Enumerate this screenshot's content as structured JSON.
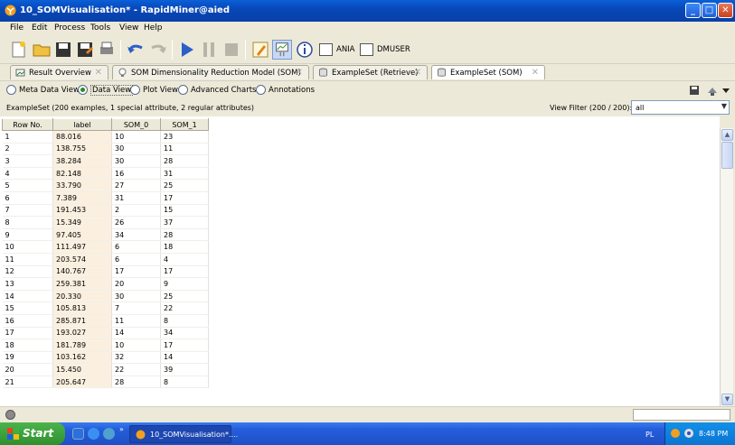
{
  "window": {
    "title": "10_SOMVisualisation* - RapidMiner@aied",
    "min": "_",
    "max": "□",
    "close": "✕"
  },
  "menu": [
    "File",
    "Edit",
    "Process",
    "Tools",
    "View",
    "Help"
  ],
  "toolbar": {
    "check1_label": "ANIA",
    "check2_label": "DMUSER"
  },
  "tabs": [
    {
      "label": "Result Overview",
      "icon": "result-overview-icon"
    },
    {
      "label": "SOM Dimensionality Reduction Model (SOM)",
      "icon": "lightbulb-icon"
    },
    {
      "label": "ExampleSet (Retrieve)",
      "icon": "table-icon"
    },
    {
      "label": "ExampleSet (SOM)",
      "icon": "table-icon"
    }
  ],
  "views": [
    "Meta Data View",
    "Data View",
    "Plot View",
    "Advanced Charts",
    "Annotations"
  ],
  "selected_view": "Data View",
  "info": {
    "summary": "ExampleSet (200 examples, 1 special attribute, 2 regular attributes)",
    "view_filter_label": "View Filter (200 / 200):",
    "filter_value": "all"
  },
  "table": {
    "columns": [
      "Row No.",
      "label",
      "SOM_0",
      "SOM_1"
    ],
    "rows": [
      [
        "1",
        "88.016",
        "10",
        "23"
      ],
      [
        "2",
        "138.755",
        "30",
        "11"
      ],
      [
        "3",
        "38.284",
        "30",
        "28"
      ],
      [
        "4",
        "82.148",
        "16",
        "31"
      ],
      [
        "5",
        "33.790",
        "27",
        "25"
      ],
      [
        "6",
        "7.389",
        "31",
        "17"
      ],
      [
        "7",
        "191.453",
        "2",
        "15"
      ],
      [
        "8",
        "15.349",
        "26",
        "37"
      ],
      [
        "9",
        "97.405",
        "34",
        "28"
      ],
      [
        "10",
        "111.497",
        "6",
        "18"
      ],
      [
        "11",
        "203.574",
        "6",
        "4"
      ],
      [
        "12",
        "140.767",
        "17",
        "17"
      ],
      [
        "13",
        "259.381",
        "20",
        "9"
      ],
      [
        "14",
        "20.330",
        "30",
        "25"
      ],
      [
        "15",
        "105.813",
        "7",
        "22"
      ],
      [
        "16",
        "285.871",
        "11",
        "8"
      ],
      [
        "17",
        "193.027",
        "14",
        "34"
      ],
      [
        "18",
        "181.789",
        "10",
        "17"
      ],
      [
        "19",
        "103.162",
        "32",
        "14"
      ],
      [
        "20",
        "15.450",
        "22",
        "39"
      ],
      [
        "21",
        "205.647",
        "28",
        "8"
      ]
    ]
  },
  "taskbar": {
    "start": "Start",
    "task": "10_SOMVisualisation*....",
    "lang": "PL",
    "clock": "8:48 PM"
  }
}
